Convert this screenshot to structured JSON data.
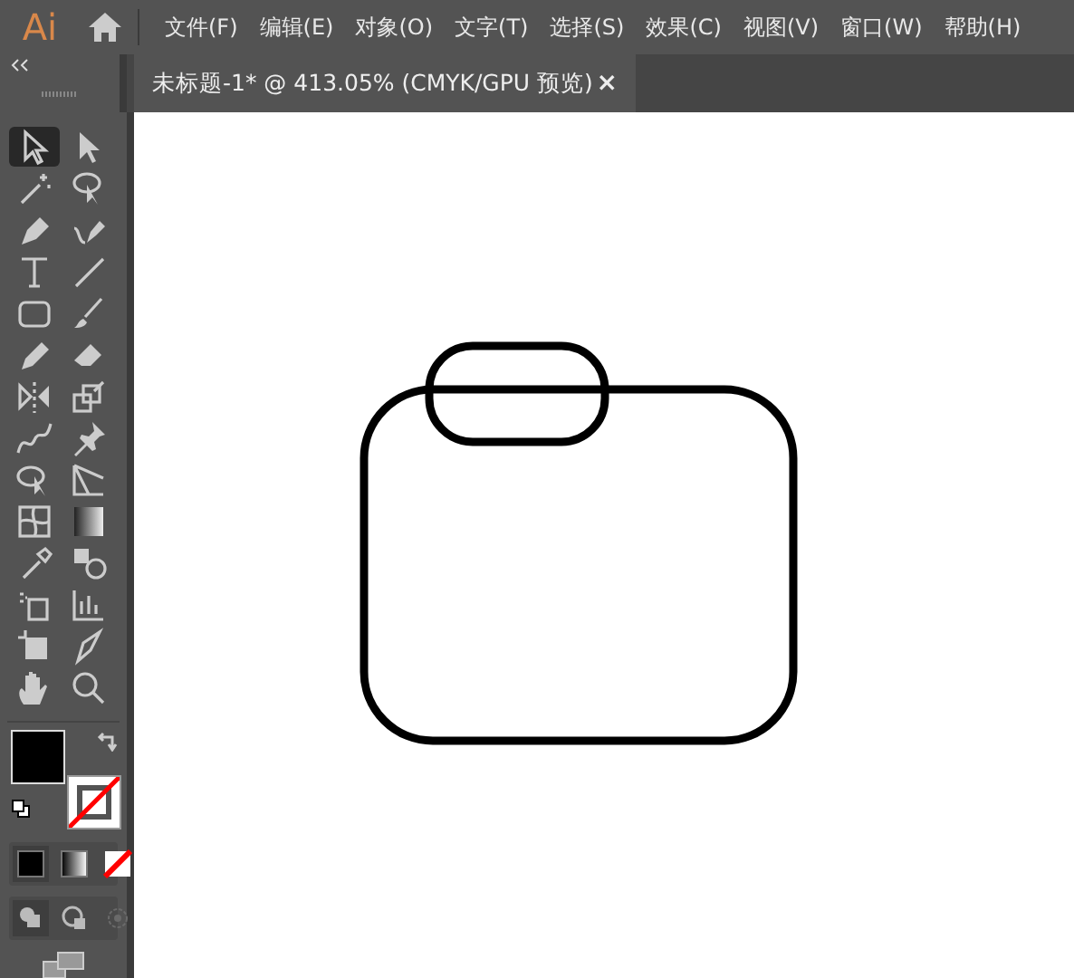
{
  "app": {
    "logo": "Ai"
  },
  "menus": [
    {
      "label": "文件(F)"
    },
    {
      "label": "编辑(E)"
    },
    {
      "label": "对象(O)"
    },
    {
      "label": "文字(T)"
    },
    {
      "label": "选择(S)"
    },
    {
      "label": "效果(C)"
    },
    {
      "label": "视图(V)"
    },
    {
      "label": "窗口(W)"
    },
    {
      "label": "帮助(H)"
    }
  ],
  "document_tab": {
    "title": "未标题-1* @ 413.05% (CMYK/GPU 预览)",
    "close": "×",
    "selected": true
  },
  "tools": [
    {
      "kind": "select",
      "selected": true
    },
    {
      "kind": "direct",
      "selected": false
    },
    {
      "kind": "wand",
      "selected": false
    },
    {
      "kind": "lasso",
      "selected": false
    },
    {
      "kind": "pen",
      "selected": false
    },
    {
      "kind": "curvature",
      "selected": false
    },
    {
      "kind": "type",
      "selected": false
    },
    {
      "kind": "line",
      "selected": false
    },
    {
      "kind": "rect",
      "selected": false
    },
    {
      "kind": "brush",
      "selected": false
    },
    {
      "kind": "pencil",
      "selected": false
    },
    {
      "kind": "eraser",
      "selected": false
    },
    {
      "kind": "reflect",
      "selected": false
    },
    {
      "kind": "scale",
      "selected": false
    },
    {
      "kind": "warp",
      "selected": false
    },
    {
      "kind": "pin",
      "selected": false
    },
    {
      "kind": "shapebuilder",
      "selected": false
    },
    {
      "kind": "perspective",
      "selected": false
    },
    {
      "kind": "mesh",
      "selected": false
    },
    {
      "kind": "gradient",
      "selected": false
    },
    {
      "kind": "eyedropper",
      "selected": false
    },
    {
      "kind": "blend",
      "selected": false
    },
    {
      "kind": "spray",
      "selected": false
    },
    {
      "kind": "graph",
      "selected": false
    },
    {
      "kind": "artboard",
      "selected": false
    },
    {
      "kind": "knife",
      "selected": false
    },
    {
      "kind": "hand",
      "selected": false
    },
    {
      "kind": "zoom",
      "selected": false
    }
  ],
  "fill_stroke": {
    "fill": {
      "kind": "solid",
      "color": "#000000"
    },
    "stroke": {
      "kind": "none"
    }
  },
  "color_modes": [
    {
      "kind": "color",
      "selected": true
    },
    {
      "kind": "gradient",
      "selected": false
    },
    {
      "kind": "none",
      "selected": false
    }
  ],
  "draw_modes": [
    {
      "kind": "normal",
      "selected": true
    },
    {
      "kind": "behind",
      "selected": false
    },
    {
      "kind": "inside",
      "selected": false,
      "disabled": true
    }
  ]
}
